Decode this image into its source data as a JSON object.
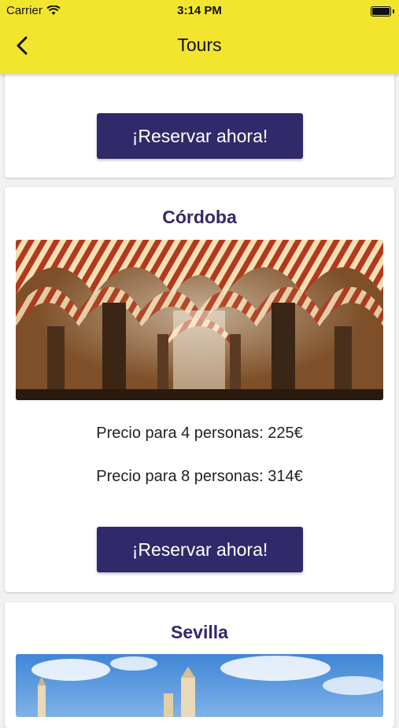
{
  "status_bar": {
    "carrier": "Carrier",
    "time": "3:14 PM"
  },
  "nav": {
    "title": "Tours",
    "back_icon": "chevron-left-icon"
  },
  "tours": [
    {
      "button_label": "¡Reservar ahora!"
    },
    {
      "city": "Córdoba",
      "image_subject": "mezquita-arches-photo",
      "price_4": "Precio para 4 personas: 225€",
      "price_8": "Precio para 8 personas: 314€",
      "button_label": "¡Reservar ahora!"
    },
    {
      "city": "Sevilla",
      "image_subject": "seville-skyline-photo"
    }
  ],
  "colors": {
    "header": "#f2e52e",
    "accent": "#302a6b"
  }
}
